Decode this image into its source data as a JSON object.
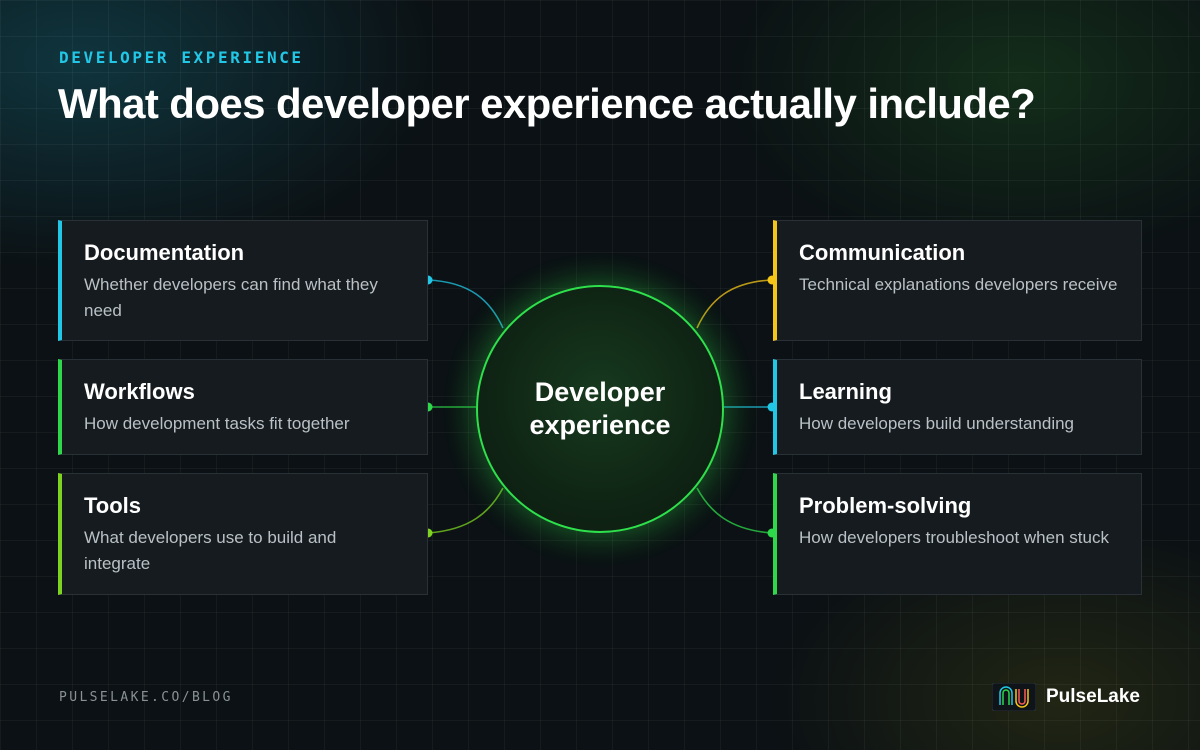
{
  "header": {
    "eyebrow": "DEVELOPER EXPERIENCE",
    "title": "What does developer experience actually include?"
  },
  "hub": {
    "label": "Developer experience"
  },
  "cards": [
    {
      "title": "Documentation",
      "description": "Whether developers can find what they need",
      "color": "#22c7e6"
    },
    {
      "title": "Workflows",
      "description": "How development tasks fit together",
      "color": "#2ed84a"
    },
    {
      "title": "Tools",
      "description": "What developers use to build and integrate",
      "color": "#7ed321"
    },
    {
      "title": "Communication",
      "description": "Technical explanations developers receive",
      "color": "#f5c518"
    },
    {
      "title": "Learning",
      "description": "How developers build understanding",
      "color": "#22c7e6"
    },
    {
      "title": "Problem-solving",
      "description": "How developers troubleshoot when stuck",
      "color": "#2ed84a"
    }
  ],
  "footer": {
    "url": "PULSELAKE.CO/BLOG",
    "brand": "PulseLake",
    "logo_icon": "pulselake-logo-icon"
  }
}
